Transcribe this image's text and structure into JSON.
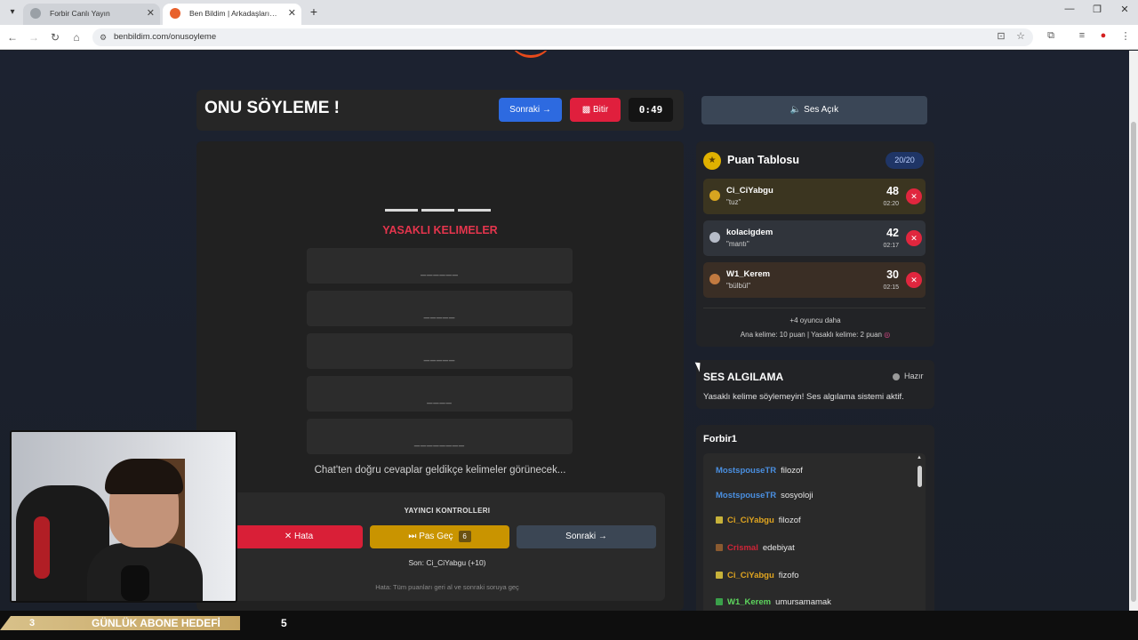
{
  "browser": {
    "tabs": [
      {
        "title": "Forbir Canlı Yayın",
        "active": false
      },
      {
        "title": "Ben Bildim | Arkadaşlarınla Online",
        "active": true
      }
    ],
    "url": "benbildim.com/onusoyleme"
  },
  "header": {
    "title": "ONU SÖYLEME !",
    "next_label": "Sonraki →",
    "finish_label": "Bitir",
    "timer": "0:49"
  },
  "game": {
    "forbidden_title": "YASAKLI KELIMELER",
    "forbidden_masks": [
      "______",
      "_____",
      "_____",
      "____",
      "________"
    ],
    "chat_hint": "Chat'ten doğru cevaplar geldikçe kelimeler görünecek..."
  },
  "controls": {
    "title": "YAYINCI KONTROLLERI",
    "error_label": "Hata",
    "pass_label": "Pas Geç",
    "pass_count": "6",
    "next_label": "Sonraki →",
    "last": "Son: Ci_CiYabgu (+10)",
    "hint": "Hata: Tüm puanları geri al ve sonraki soruya geç"
  },
  "sound": {
    "label": "Ses Açık"
  },
  "scoreboard": {
    "title": "Puan Tablosu",
    "count": "20/20",
    "rows": [
      {
        "player": "Ci_CiYabgu",
        "guess": "\"tuz\"",
        "points": "48",
        "time": "02:20",
        "tint": "#3b3520",
        "medal": "#d7a520"
      },
      {
        "player": "kolacigdem",
        "guess": "\"mantı\"",
        "points": "42",
        "time": "02:17",
        "tint": "#30343b",
        "medal": "#b6bcc8"
      },
      {
        "player": "W1_Kerem",
        "guess": "\"bülbül\"",
        "points": "30",
        "time": "02:15",
        "tint": "#3a2e25",
        "medal": "#c27a40"
      }
    ],
    "more": "+4 oyuncu daha",
    "info": "Ana kelime: 10 puan | Yasaklı kelime: 2 puan"
  },
  "voice": {
    "title": "SES ALGILAMA",
    "status": "Hazır",
    "description": "Yasaklı kelime söylemeyin! Ses algılama sistemi aktif."
  },
  "chat": {
    "title": "Forbir1",
    "messages": [
      {
        "user": "MostspouseTR",
        "text": "filozof",
        "color": "#4a8fe0",
        "badge": ""
      },
      {
        "user": "MostspouseTR",
        "text": "sosyoloji",
        "color": "#4a8fe0",
        "badge": ""
      },
      {
        "user": "Ci_CiYabgu",
        "text": "filozof",
        "color": "#e0a520",
        "badge": "#c7b23a"
      },
      {
        "user": "Crismal",
        "text": "edebiyat",
        "color": "#d02538",
        "badge": "#8a5a30"
      },
      {
        "user": "Ci_CiYabgu",
        "text": "fizofo",
        "color": "#e0a520",
        "badge": "#c7b23a"
      },
      {
        "user": "W1_Kerem",
        "text": "umursamamak",
        "color": "#5ed65e",
        "badge": "#3aa04a"
      }
    ]
  },
  "ticker": {
    "start": "3",
    "label": "GÜNLÜK ABONE HEDEFİ",
    "goal": "5"
  }
}
